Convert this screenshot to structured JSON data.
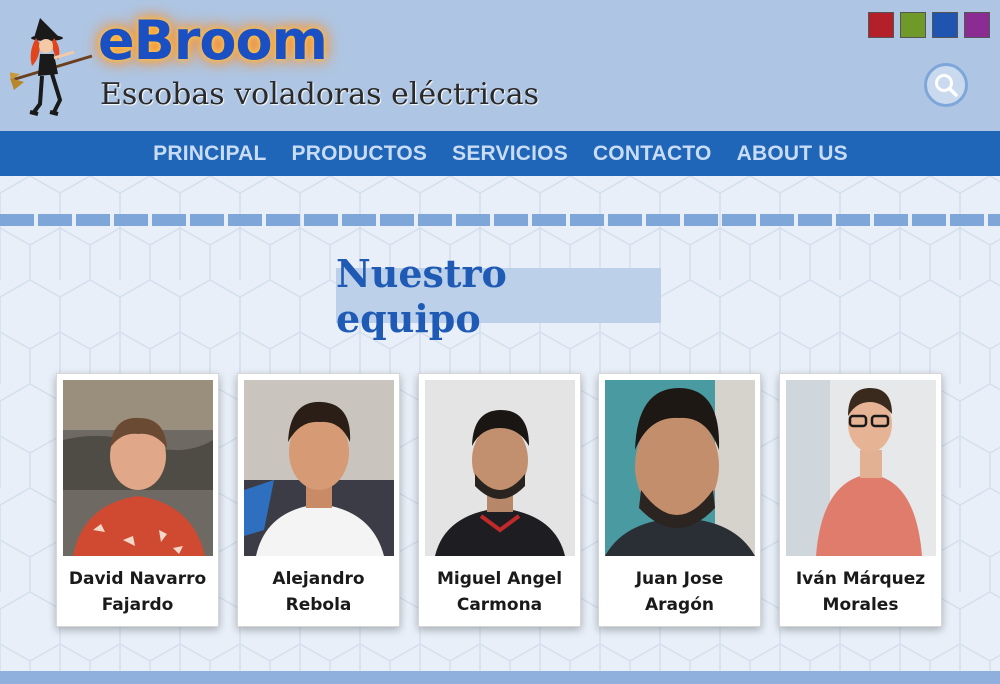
{
  "header": {
    "brand": "eBroom",
    "tagline": "Escobas voladoras eléctricas",
    "theme_swatches": [
      {
        "name": "red",
        "color": "#b3202a"
      },
      {
        "name": "green",
        "color": "#6f9a2a"
      },
      {
        "name": "blue",
        "color": "#1f55b0"
      },
      {
        "name": "purple",
        "color": "#8a2c91"
      }
    ],
    "search_icon": "search-icon"
  },
  "nav": {
    "items": [
      {
        "label": "PRINCIPAL"
      },
      {
        "label": "PRODUCTOS"
      },
      {
        "label": "SERVICIOS"
      },
      {
        "label": "CONTACTO"
      },
      {
        "label": "ABOUT US"
      }
    ]
  },
  "main": {
    "title": "Nuestro equipo",
    "team": [
      {
        "first": "David Navarro",
        "last": "Fajardo"
      },
      {
        "first": "Alejandro",
        "last": "Rebola"
      },
      {
        "first": "Miguel Angel",
        "last": "Carmona"
      },
      {
        "first": "Juan Jose",
        "last": "Aragón"
      },
      {
        "first": "Iván Márquez",
        "last": "Morales"
      }
    ]
  },
  "colors": {
    "header_bg": "#aec6e4",
    "nav_bg": "#2066b8",
    "nav_text": "#c9dcf5",
    "accent": "#1f5bb5",
    "page_bg": "#e8eff8"
  }
}
